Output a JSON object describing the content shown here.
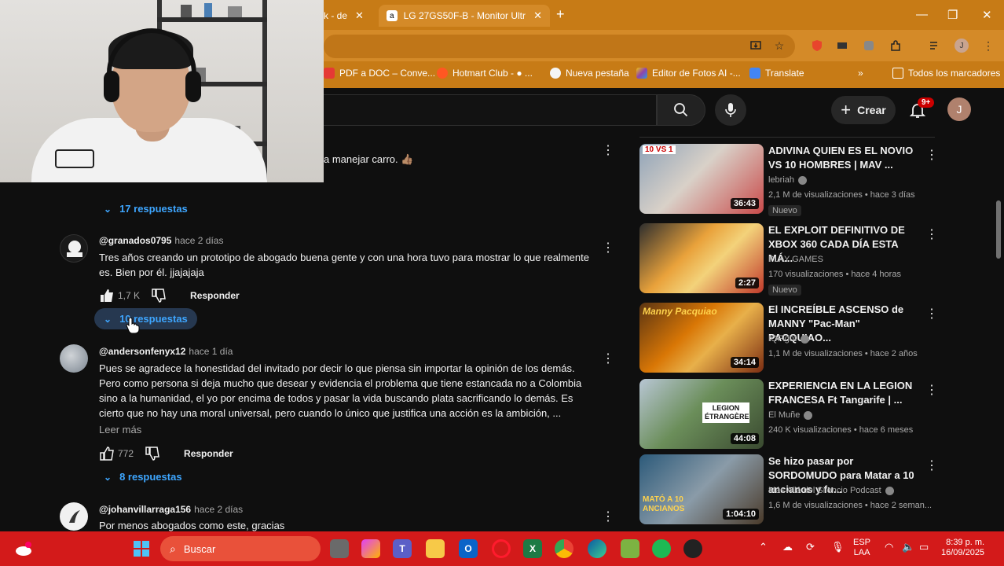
{
  "browser": {
    "tabs": [
      {
        "label": "k - de",
        "close": "✕"
      },
      {
        "label": "LG 27GS50F-B - Monitor Ultrag",
        "close": "✕",
        "favicon": "a"
      }
    ],
    "new_tab": "+",
    "window_controls": {
      "minimize": "—",
      "maximize": "❐",
      "close": "✕"
    },
    "profile_initial": "J",
    "bookmarks": [
      {
        "label": "PDF a DOC – Conve...",
        "color": "#e53935"
      },
      {
        "label": "Hotmart Club - ● ...",
        "color": "#ff5722"
      },
      {
        "label": "Nueva pestaña",
        "color": "#f5f5f5"
      },
      {
        "label": "Editor de Fotos AI -...",
        "color": "#8e44ad"
      },
      {
        "label": "Translate",
        "color": "#4285f4"
      }
    ],
    "bookmarks_more": "»",
    "all_bookmarks": "Todos los marcadores"
  },
  "youtube": {
    "create_label": "Crear",
    "create_plus": "+",
    "notif_badge": "9+",
    "user_initial": "J"
  },
  "comments": [
    {
      "partial_text": "a manejar carro. 👍🏽",
      "replies": "17 respuestas"
    },
    {
      "author": "@granados0795",
      "ago": "hace 2 días",
      "text": "Tres años creando un prototipo de abogado buena gente y con una hora tuvo para mostrar lo que realmente es. Bien por él. jjajajaja",
      "likes": "1,7 K",
      "reply_label": "Responder",
      "replies": "10 respuestas"
    },
    {
      "author": "@andersonfenyx12",
      "ago": "hace 1 día",
      "text": "Pues se agradece la honestidad del invitado por decir lo que piensa sin importar la opinión de los demás. Pero como persona si deja mucho que desear y evidencia el problema que tiene estancada no a Colombia sino a la humanidad, el yo por encima de todos y pasar la vida buscando plata sacrificando lo demás. Es cierto que no hay una moral universal, pero cuando lo único que justifica una acción es la ambición, ...",
      "read_more": "Leer más",
      "likes": "772",
      "reply_label": "Responder",
      "replies": "8 respuestas"
    },
    {
      "author": "@johanvillarraga156",
      "ago": "hace 2 días",
      "text": "Por menos abogados como este, gracias"
    }
  ],
  "videos": [
    {
      "title": "ADIVINA QUIEN ES EL NOVIO VS 10 HOMBRES | MAV ...",
      "channel": "lebriah",
      "meta": "2,1 M de visualizaciones • hace 3 días",
      "badge": "Nuevo",
      "duration": "36:43",
      "thumb_label": "10 VS 1",
      "colors": [
        "#7a8fa6",
        "#c94a4a"
      ]
    },
    {
      "title": "EL EXPLOIT DEFINITIVO DE XBOX 360 CADA DÍA ESTA MÁ...",
      "channel": "PLAY GAMES",
      "meta": "170 visualizaciones • hace 4 horas",
      "badge": "Nuevo",
      "duration": "2:27",
      "colors": [
        "#e9a23b",
        "#c0392b"
      ]
    },
    {
      "title": "El INCREÍBLE ASCENSO de MANNY \"Pac-Man\" PACQUIAO...",
      "channel": "IQFight",
      "meta": "1,1 M de visualizaciones • hace 2 años",
      "duration": "34:14",
      "thumb_label": "Manny Pacquiao",
      "colors": [
        "#d97706",
        "#7c2d12"
      ]
    },
    {
      "title": "EXPERIENCIA EN LA LEGION FRANCESA Ft Tangarife | ...",
      "channel": "El Muñe",
      "meta": "240 K visualizaciones • hace 6 meses",
      "duration": "44:08",
      "thumb_label": "LEGION ÉTRANGÈRE",
      "colors": [
        "#6b8e5a",
        "#b8c6d4"
      ]
    },
    {
      "title": "Se hizo pasar por SORDOMUDO para Matar a 10 ancianos y fu...",
      "channel": "Más Allá del Silencio Podcast",
      "meta": "1,6 M de visualizaciones • hace 2 seman...",
      "duration": "1:04:10",
      "thumb_label": "MATÓ A 10 ANCIANOS",
      "colors": [
        "#2c5a7a",
        "#c0392b"
      ]
    }
  ],
  "taskbar": {
    "search_label": "Buscar",
    "lang_top": "ESP",
    "lang_bottom": "LAA",
    "time": "8:39 p. m.",
    "date": "16/09/2025"
  }
}
